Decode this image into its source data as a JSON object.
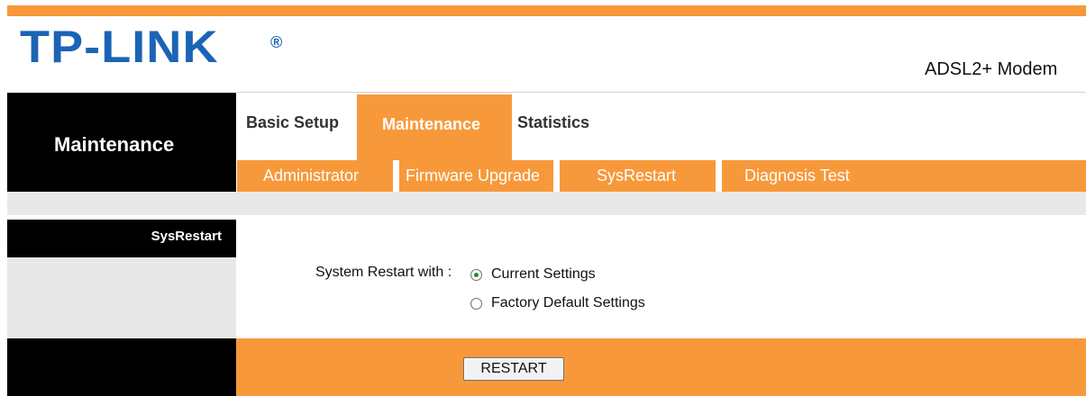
{
  "header": {
    "logo_text": "TP-LINK",
    "logo_mark": "®",
    "product": "ADSL2+ Modem"
  },
  "nav": {
    "section_title": "Maintenance",
    "tabs": [
      {
        "label": "Basic Setup",
        "active": false
      },
      {
        "label": "Maintenance",
        "active": true
      },
      {
        "label": "Statistics",
        "active": false
      }
    ],
    "subtabs": [
      {
        "label": "Administrator",
        "active": false
      },
      {
        "label": "Firmware Upgrade",
        "active": false
      },
      {
        "label": "SysRestart",
        "active": true
      },
      {
        "label": "Diagnosis Test",
        "active": false
      }
    ]
  },
  "content": {
    "left_label": "SysRestart",
    "field_label": "System Restart with :",
    "options": [
      {
        "label": "Current Settings",
        "checked": true
      },
      {
        "label": "Factory Default Settings",
        "checked": false
      }
    ],
    "button_label": "RESTART"
  },
  "colors": {
    "accent": "#f7993a",
    "logo": "#1b64b5",
    "sidebar": "#000000",
    "band": "#e8e8e8"
  }
}
